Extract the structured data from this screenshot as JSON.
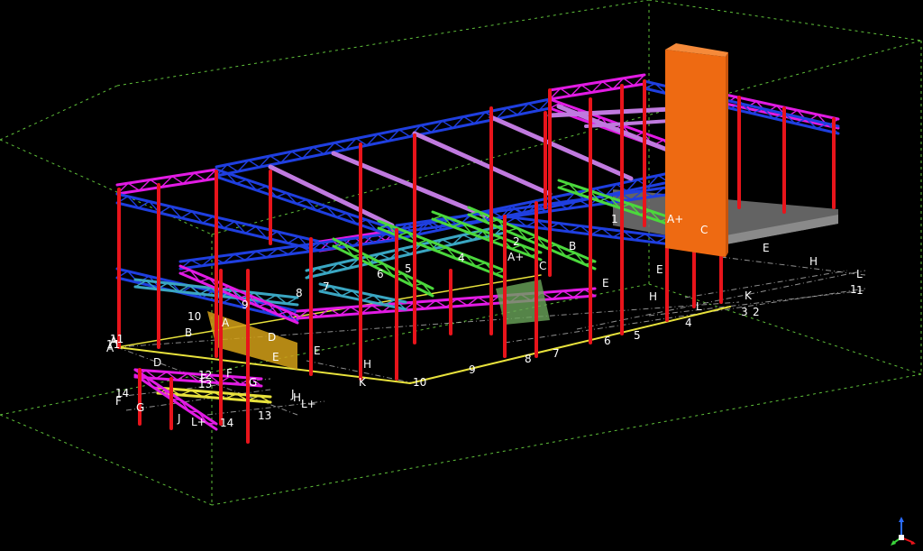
{
  "viewer": {
    "background": "#000000",
    "view_type": "3d-isometric-model"
  },
  "colors": {
    "column": "#e8141b",
    "beam_blue": "#1f3fe0",
    "beam_magenta": "#e21be4",
    "beam_violet": "#c07adf",
    "beam_green": "#4bd83c",
    "beam_cyan": "#3aa6c2",
    "beam_yellow": "#e8e23c",
    "slab_gray": "#6e6e6e",
    "shaft_orange": "#ee6a12",
    "bounding_box": "#5fbf3a",
    "grid_label": "#ffffff"
  },
  "grid_labels": [
    "E",
    "H",
    "L",
    "1",
    "K",
    "3",
    "2",
    "E",
    "H",
    "L",
    "4",
    "E",
    "5",
    "6",
    "A+",
    "C",
    "B",
    "1",
    "A+",
    "C",
    "2",
    "4",
    "6",
    "5",
    "7",
    "8",
    "9",
    "A",
    "D",
    "E",
    "E",
    "10",
    "B",
    "11",
    "A",
    "H",
    "K",
    "9",
    "10",
    "8",
    "7",
    "D",
    "12",
    "E",
    "F",
    "13",
    "14",
    "F",
    "G",
    "J",
    "L+",
    "14",
    "13",
    "G",
    "J",
    "L+",
    "11",
    "1",
    "A",
    "H"
  ],
  "axis_indicator": {
    "icon": "xyz-axis-icon"
  }
}
